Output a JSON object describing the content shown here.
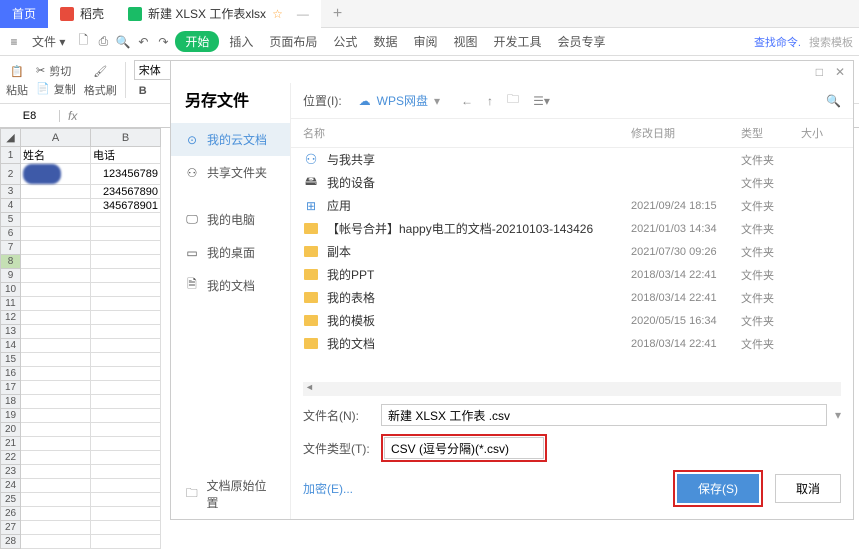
{
  "tabs": {
    "home": "首页",
    "red": "稻壳",
    "active": "新建 XLSX 工作表xlsx"
  },
  "menubar": {
    "file": "文件",
    "start": "开始",
    "items": [
      "插入",
      "页面布局",
      "公式",
      "数据",
      "审阅",
      "视图",
      "开发工具",
      "会员专享"
    ],
    "search1": "查找命令.",
    "search2": "搜索模板"
  },
  "toolbar": {
    "paste": "粘贴",
    "cut": "剪切",
    "copy": "复制",
    "format_painter": "格式刷",
    "font": "宋体",
    "bold": "B"
  },
  "formula": {
    "cell": "E8"
  },
  "sheet": {
    "cols": [
      "A",
      "B"
    ],
    "headers": {
      "A": "姓名",
      "B": "电话"
    },
    "rows": [
      {
        "A": "__avatar__",
        "B": "123456789"
      },
      {
        "A": "",
        "B": "234567890"
      },
      {
        "A": "",
        "B": "345678901"
      }
    ]
  },
  "dialog": {
    "title": "另存文件",
    "nav": [
      {
        "label": "我的云文档",
        "icon": "cloud",
        "active": true
      },
      {
        "label": "共享文件夹",
        "icon": "share"
      },
      {
        "label": "我的电脑",
        "icon": "computer"
      },
      {
        "label": "我的桌面",
        "icon": "desktop"
      },
      {
        "label": "我的文档",
        "icon": "doc"
      }
    ],
    "loc_footer": "文档原始位置",
    "location_label": "位置(I):",
    "location_value": "WPS网盘",
    "columns": {
      "name": "名称",
      "date": "修改日期",
      "type": "类型",
      "size": "大小"
    },
    "files": [
      {
        "name": "与我共享",
        "date": "",
        "type": "文件夹",
        "icon": "share"
      },
      {
        "name": "我的设备",
        "date": "",
        "type": "文件夹",
        "icon": "device"
      },
      {
        "name": "应用",
        "date": "2021/09/24 18:15",
        "type": "文件夹",
        "icon": "grid"
      },
      {
        "name": "【帐号合并】happy电工的文档-20210103-143426",
        "date": "2021/01/03 14:34",
        "type": "文件夹",
        "icon": "folder"
      },
      {
        "name": "副本",
        "date": "2021/07/30 09:26",
        "type": "文件夹",
        "icon": "folder"
      },
      {
        "name": "我的PPT",
        "date": "2018/03/14 22:41",
        "type": "文件夹",
        "icon": "folder"
      },
      {
        "name": "我的表格",
        "date": "2018/03/14 22:41",
        "type": "文件夹",
        "icon": "folder"
      },
      {
        "name": "我的模板",
        "date": "2020/05/15 16:34",
        "type": "文件夹",
        "icon": "folder"
      },
      {
        "name": "我的文档",
        "date": "2018/03/14 22:41",
        "type": "文件夹",
        "icon": "folder"
      }
    ],
    "filename_label": "文件名(N):",
    "filename_value": "新建 XLSX 工作表 .csv",
    "filetype_label": "文件类型(T):",
    "filetype_value": "CSV (逗号分隔)(*.csv)",
    "encrypt": "加密(E)...",
    "save": "保存(S)",
    "cancel": "取消"
  }
}
